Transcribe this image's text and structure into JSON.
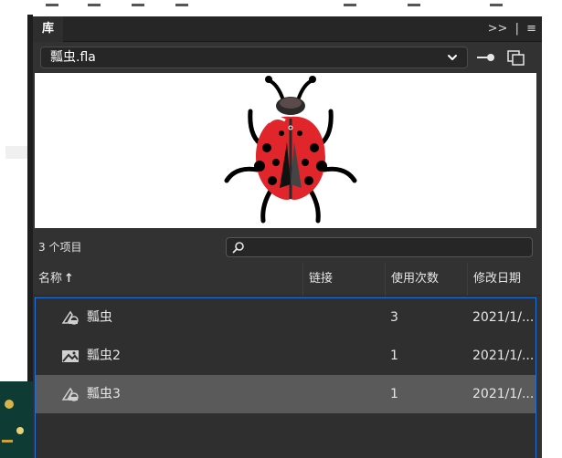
{
  "panel": {
    "tab_label": "库",
    "controls": [
      ">>",
      "|",
      "≡"
    ]
  },
  "document": {
    "selected": "瓢虫.fla"
  },
  "library": {
    "item_count": "3 个项目",
    "search_placeholder": "",
    "columns": [
      "名称",
      "链接",
      "使用次数",
      "修改日期"
    ],
    "sort_arrow": "↑",
    "items": [
      {
        "icon": "graphic-symbol-icon",
        "name": "瓢虫",
        "link": "",
        "uses": "3",
        "modified": "2021/1/..."
      },
      {
        "icon": "movie-clip-icon",
        "name": "瓢虫2",
        "link": "",
        "uses": "1",
        "modified": "2021/1/..."
      },
      {
        "icon": "graphic-symbol-icon",
        "name": "瓢虫3",
        "link": "",
        "uses": "1",
        "modified": "2021/1/..."
      }
    ],
    "selected_index": 2
  },
  "colors": {
    "panel_bg": "#323232",
    "selection_bg": "#5a5a5a",
    "focus_border": "#1e6fd8",
    "ladybug_red": "#e0262b"
  }
}
